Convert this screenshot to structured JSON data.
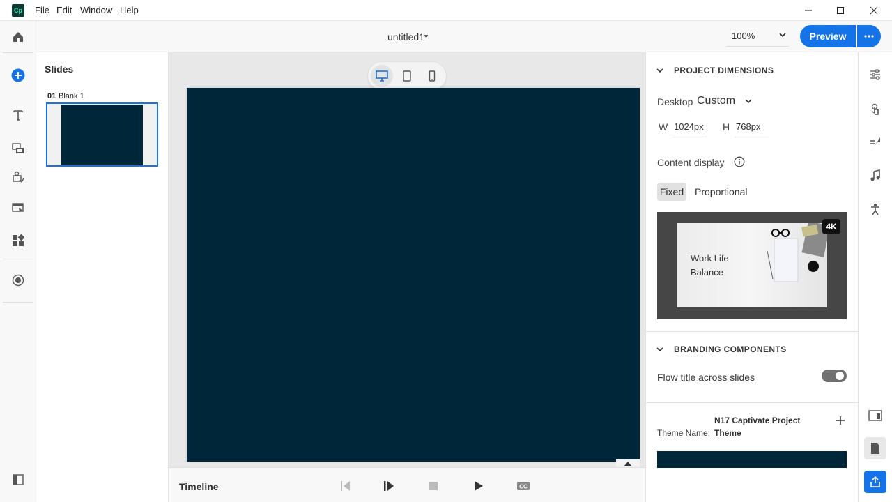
{
  "app": {
    "logo_text": "Cp"
  },
  "menu": {
    "items": [
      "File",
      "Edit",
      "Window",
      "Help"
    ]
  },
  "header": {
    "doc_title": "untitled1*",
    "zoom": "100%",
    "preview_label": "Preview"
  },
  "slides": {
    "heading": "Slides",
    "items": [
      {
        "number": "01",
        "name": "Blank 1"
      }
    ]
  },
  "timeline": {
    "label": "Timeline"
  },
  "properties": {
    "project_dimensions": {
      "title": "PROJECT DIMENSIONS",
      "device_label": "Desktop",
      "preset": "Custom",
      "width_label": "W",
      "width_value": "1024px",
      "height_label": "H",
      "height_value": "768px",
      "content_display_label": "Content display",
      "display_options": [
        "Fixed",
        "Proportional"
      ],
      "selected_display": "Fixed",
      "theme_preview": {
        "line1": "Work Life",
        "line2": "Balance",
        "badge": "4K"
      }
    },
    "branding": {
      "title": "BRANDING COMPONENTS",
      "flow_title_label": "Flow title across slides",
      "flow_title_on": true
    },
    "theme": {
      "project_name": "N17 Captivate Project",
      "theme_name_label": "Theme Name:",
      "theme_name_value": "Theme",
      "swatch_color": "#00263a"
    }
  },
  "colors": {
    "accent": "#1473e6",
    "stage_background": "#00263a"
  }
}
